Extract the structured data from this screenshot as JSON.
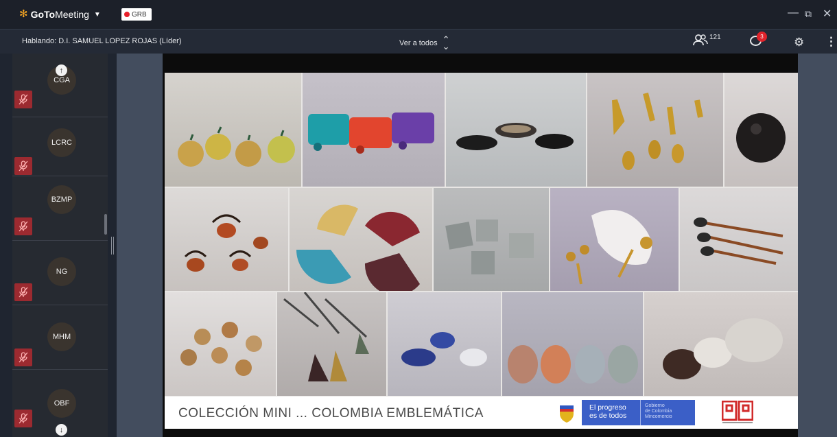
{
  "titlebar": {
    "app_name_bold": "GoTo",
    "app_name_rest": "Meeting",
    "badge_text": "GRB",
    "minimize": "—",
    "restore": "⧉",
    "close": "✕"
  },
  "infobar": {
    "speaking": "Hablando: D.I. SAMUEL LOPEZ ROJAS (Líder)",
    "view": "Ver a todos",
    "attendee_count": "121",
    "chat_unread": "3"
  },
  "participants": [
    {
      "initials": "CGA"
    },
    {
      "initials": "LCRC"
    },
    {
      "initials": "BZMP"
    },
    {
      "initials": "NG"
    },
    {
      "initials": "MHM"
    },
    {
      "initials": "OBF"
    }
  ],
  "slide": {
    "caption": "COLECCIÓN MINI ... COLOMBIA  EMBLEMÁTICA",
    "gov_line1": "El progreso",
    "gov_line2": "es de todos",
    "gov_small1": "Gobierno",
    "gov_small2": "de Colombia",
    "gov_small3": "Mincomercio"
  }
}
